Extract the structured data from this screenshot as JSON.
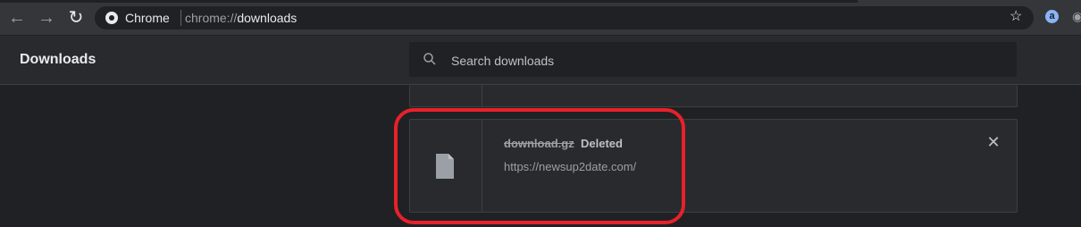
{
  "browser": {
    "site_label": "Chrome",
    "url_scheme": "chrome://",
    "url_host": "downloads",
    "extension_label": "a"
  },
  "downloads": {
    "title": "Downloads",
    "search": {
      "placeholder": "Search downloads",
      "value": ""
    },
    "items": [
      {
        "file_name": "download.gz",
        "status": "Deleted",
        "url": "https://newsup2date.com/",
        "icon": "file-icon"
      }
    ]
  },
  "colors": {
    "highlight": "#e8212a",
    "background": "#202124",
    "card": "#292a2d"
  }
}
